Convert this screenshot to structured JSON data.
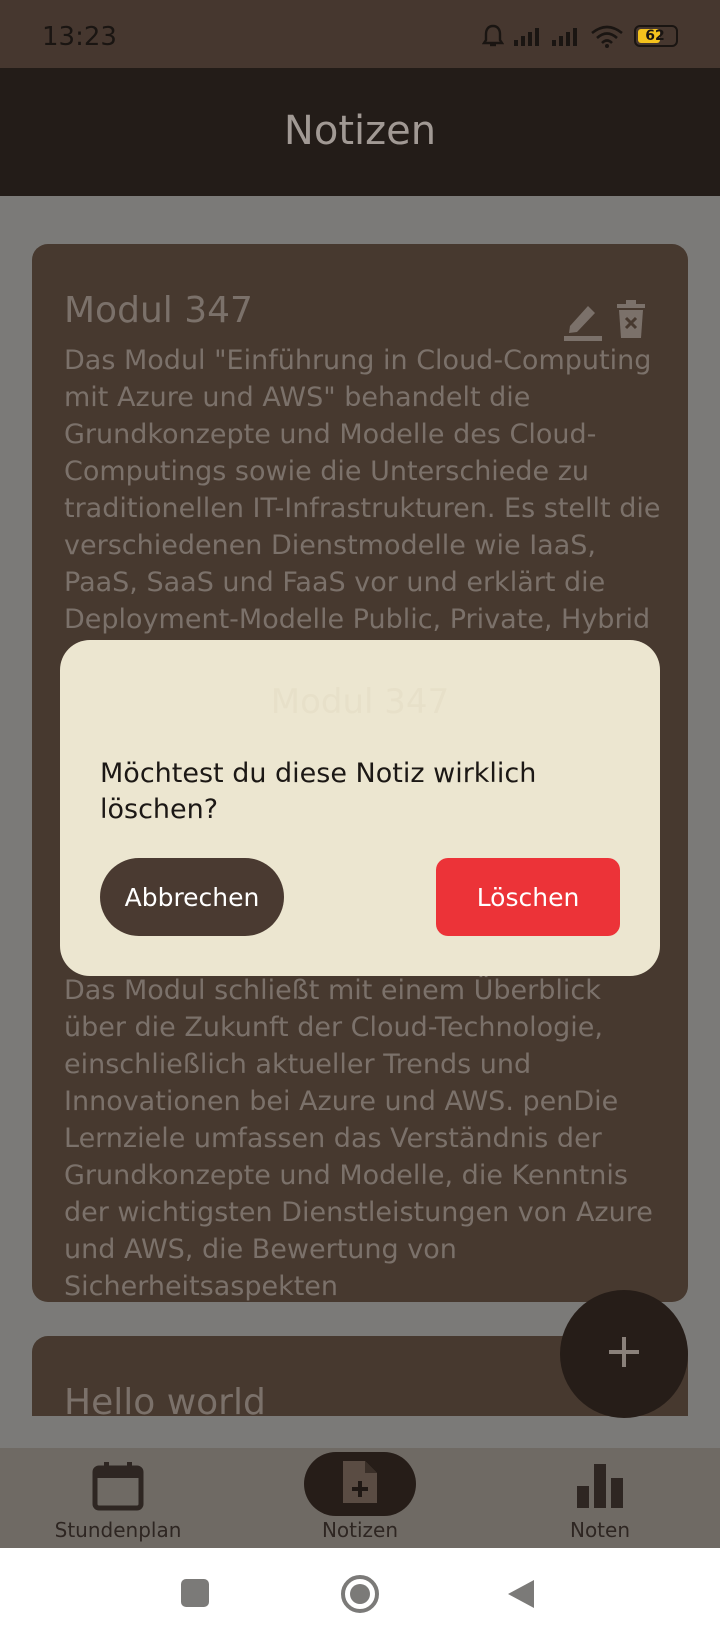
{
  "status_bar": {
    "time": "13:23",
    "battery": "62"
  },
  "app_bar": {
    "title": "Notizen"
  },
  "notes": [
    {
      "title": "Modul 347",
      "body_top": "Das Modul \"Einführung in Cloud-Computing mit Azure und AWS\" behandelt die Grundkonzepte und Modelle des Cloud-Computings sowie die Unterschiede zu traditionellen IT-Infrastrukturen. Es stellt die verschiedenen Dienstmodelle wie IaaS, PaaS, SaaS und FaaS vor und erklärt die Deployment-Modelle Public, Private, Hybrid",
      "body_bottom": "Das Modul schließt mit einem Überblick über die Zukunft der Cloud-Technologie, einschließlich aktueller Trends und Innovationen bei Azure und AWS. penDie Lernziele umfassen das Verständnis der Grundkonzepte und Modelle, die Kenntnis der wichtigsten Dienstleistungen von Azure und AWS, die Bewertung von Sicherheitsaspekten"
    },
    {
      "title": "Hello world"
    }
  ],
  "dialog": {
    "ghost_title": "Modul 347",
    "message": "Möchtest du diese Notiz wirklich löschen?",
    "cancel_label": "Abbrechen",
    "delete_label": "Löschen"
  },
  "bottom_nav": {
    "items": [
      {
        "label": "Stundenplan",
        "icon": "calendar-icon"
      },
      {
        "label": "Notizen",
        "icon": "note-add-icon",
        "active": true
      },
      {
        "label": "Noten",
        "icon": "bar-chart-icon"
      }
    ]
  },
  "colors": {
    "accent_delete": "#ec3338",
    "brown_dark": "#261d18",
    "dialog_bg": "#ece6d0",
    "card_bg": "#47392f"
  }
}
